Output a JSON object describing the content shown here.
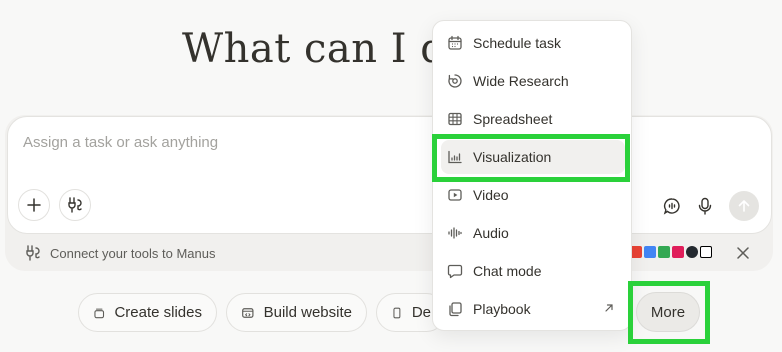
{
  "headline": "What can I do",
  "composer": {
    "placeholder": "Assign a task or ask anything"
  },
  "connect_bar": {
    "label": "Connect your tools to Manus"
  },
  "chips": [
    {
      "label": "Create slides",
      "icon": "slides-icon"
    },
    {
      "label": "Build website",
      "icon": "website-icon"
    },
    {
      "label": "De",
      "icon": "device-icon"
    }
  ],
  "more_button": {
    "label": "More"
  },
  "menu": {
    "items": [
      {
        "label": "Schedule task",
        "icon": "calendar-icon"
      },
      {
        "label": "Wide Research",
        "icon": "research-icon"
      },
      {
        "label": "Spreadsheet",
        "icon": "spreadsheet-icon"
      },
      {
        "label": "Visualization",
        "icon": "chart-icon",
        "active": true
      },
      {
        "label": "Video",
        "icon": "video-icon"
      },
      {
        "label": "Audio",
        "icon": "audio-icon"
      },
      {
        "label": "Chat mode",
        "icon": "chat-icon"
      },
      {
        "label": "Playbook",
        "icon": "playbook-icon",
        "external": true
      }
    ]
  },
  "colors": {
    "highlight": "#2ad13a",
    "background": "#f8f8f7",
    "text": "#34322d"
  }
}
